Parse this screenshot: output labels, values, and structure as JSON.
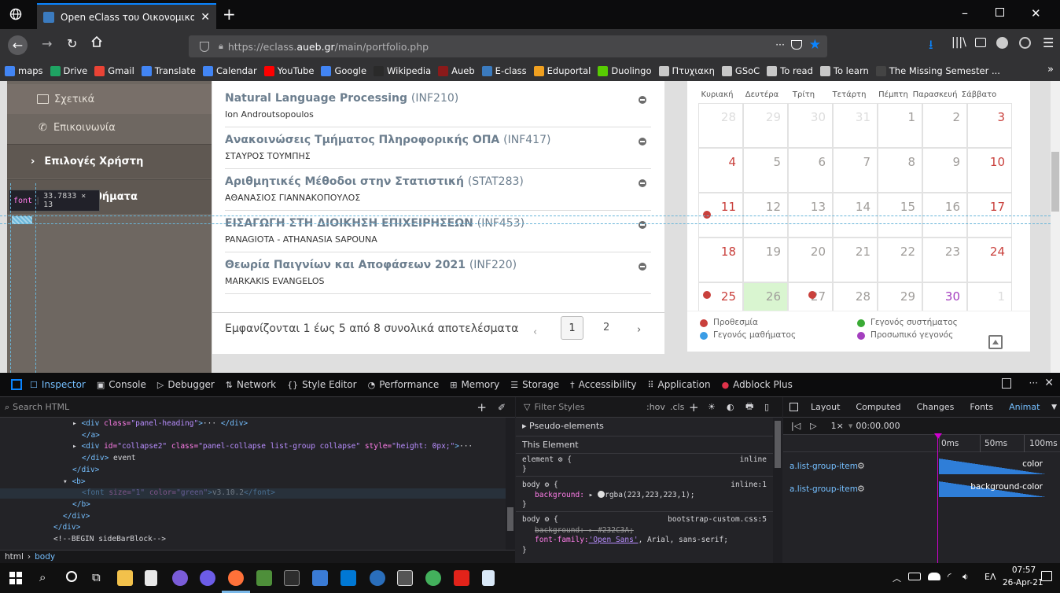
{
  "browser": {
    "tab_title": "Open eClass του Οικονομικού",
    "url_prefix": "https://eclass.",
    "url_domain": "aueb.gr",
    "url_path": "/main/portfolio.php",
    "url_more": "···"
  },
  "bookmarks": [
    {
      "label": "maps",
      "color": "#4285f4"
    },
    {
      "label": "Drive",
      "color": "#1fa463"
    },
    {
      "label": "Gmail",
      "color": "#ea4335"
    },
    {
      "label": "Translate",
      "color": "#4285f4"
    },
    {
      "label": "Calendar",
      "color": "#4285f4"
    },
    {
      "label": "YouTube",
      "color": "#ff0000"
    },
    {
      "label": "Google",
      "color": "#4285f4"
    },
    {
      "label": "Wikipedia",
      "color": "#2a2a2a"
    },
    {
      "label": "Aueb",
      "color": "#8b1a1a"
    },
    {
      "label": "E-class",
      "color": "#3b7bbf"
    },
    {
      "label": "Eduportal",
      "color": "#f0a020"
    },
    {
      "label": "Duolingo",
      "color": "#58cc02"
    },
    {
      "label": "Πτυχιακη",
      "color": "#c8c8c8"
    },
    {
      "label": "GSoC",
      "color": "#c8c8c8"
    },
    {
      "label": "To read",
      "color": "#c8c8c8"
    },
    {
      "label": "To learn",
      "color": "#c8c8c8"
    },
    {
      "label": "The Missing Semester ...",
      "color": "#444"
    }
  ],
  "sidebar": {
    "items": [
      "Σχετικά",
      "Επικοινωνία",
      "Επιλογές Χρήστη",
      "θήματα"
    ],
    "font_tooltip": "font",
    "font_tooltip_dims": "33.7833 × 13"
  },
  "courses": [
    {
      "title": "Natural Language Processing",
      "code": "(INF210)",
      "prof": "Ion Androutsopoulos"
    },
    {
      "title": "Ανακοινώσεις Τμήματος Πληροφορικής ΟΠΑ",
      "code": "(INF417)",
      "prof": "ΣΤΑΥΡΟΣ ΤΟΥΜΠΗΣ"
    },
    {
      "title": "Αριθμητικές Μέθοδοι στην Στατιστική",
      "code": "(STAT283)",
      "prof": "ΑΘΑΝΑΣΙΟΣ ΓΙΑΝΝΑΚΟΠΟΥΛΟΣ"
    },
    {
      "title": "ΕΙΣΑΓΩΓΗ ΣΤΗ ΔΙΟΙΚΗΣΗ ΕΠΙΧΕΙΡΗΣΕΩΝ",
      "code": "(INF453)",
      "prof": "PANAGIOTA - ATHANASIA SAPOUNA"
    },
    {
      "title": "Θεωρία Παιγνίων και Αποφάσεων 2021",
      "code": "(INF220)",
      "prof": "MARKAKIS EVANGELOS"
    }
  ],
  "pagination": {
    "summary": "Εμφανίζονται 1 έως 5 από 8 συνολικά αποτελέσματα",
    "prev": "‹",
    "page1": "1",
    "page2": "2",
    "next": "›"
  },
  "calendar": {
    "weekdays": [
      "Κυριακή",
      "Δευτέρα",
      "Τρίτη",
      "Τετάρτη",
      "Πέμπτη",
      "Παρασκευή",
      "Σάββατο"
    ],
    "weeks": [
      [
        "28",
        "29",
        "30",
        "31",
        "1",
        "2",
        "3"
      ],
      [
        "4",
        "5",
        "6",
        "7",
        "8",
        "9",
        "10"
      ],
      [
        "11",
        "12",
        "13",
        "14",
        "15",
        "16",
        "17"
      ],
      [
        "18",
        "19",
        "20",
        "21",
        "22",
        "23",
        "24"
      ],
      [
        "25",
        "26",
        "27",
        "28",
        "29",
        "30",
        "1"
      ]
    ],
    "today": "26",
    "legend": {
      "deadline": "Προθεσμία",
      "system": "Γεγονός συστήματος",
      "course": "Γεγονός μαθήματος",
      "personal": "Προσωπικό γεγονός"
    },
    "colors": {
      "deadline": "#c9403c",
      "system": "#3aaa35",
      "course": "#3b9de6",
      "personal": "#a43fbf",
      "today_bg": "#d9f5d0",
      "weekend": "#c9403c"
    }
  },
  "devtools": {
    "tabs": [
      "Inspector",
      "Console",
      "Debugger",
      "Network",
      "Style Editor",
      "Performance",
      "Memory",
      "Storage",
      "Accessibility",
      "Application",
      "Adblock Plus"
    ],
    "search_placeholder": "Search HTML",
    "html_lines": [
      {
        "indent": 7,
        "parts": [
          [
            "tx",
            "▸ "
          ],
          [
            "tg",
            "<div "
          ],
          [
            "at",
            "class="
          ],
          [
            "av",
            "\"panel-heading\""
          ],
          [
            "tg",
            ">"
          ],
          [
            "tx",
            "··· "
          ],
          [
            "tg",
            "</div>"
          ]
        ]
      },
      {
        "indent": 8,
        "parts": [
          [
            "tg",
            "</a>"
          ]
        ]
      },
      {
        "indent": 7,
        "parts": [
          [
            "tx",
            "▸ "
          ],
          [
            "tg",
            "<div "
          ],
          [
            "at",
            "id="
          ],
          [
            "av",
            "\"collapse2\" "
          ],
          [
            "at",
            "class="
          ],
          [
            "av",
            "\"panel-collapse list-group collapse\" "
          ],
          [
            "at",
            "style="
          ],
          [
            "av",
            "\"height: 0px;\""
          ],
          [
            "tg",
            ">"
          ],
          [
            "tx",
            "···"
          ]
        ]
      },
      {
        "indent": 8,
        "parts": [
          [
            "tg",
            "</div>"
          ],
          [
            "tx",
            " event"
          ]
        ]
      },
      {
        "indent": 7,
        "parts": [
          [
            "tg",
            "</div>"
          ]
        ]
      },
      {
        "indent": 6,
        "parts": [
          [
            "tx",
            "▾ "
          ],
          [
            "tg",
            "<b>"
          ]
        ]
      },
      {
        "indent": 8,
        "parts": [
          [
            "tg",
            "<font "
          ],
          [
            "at",
            "size="
          ],
          [
            "av",
            "\"1\" "
          ],
          [
            "at",
            "color="
          ],
          [
            "av",
            "\"green\""
          ],
          [
            "tg",
            ">"
          ],
          [
            "tx",
            "v3.10.2"
          ],
          [
            "tg",
            "</font>"
          ]
        ]
      },
      {
        "indent": 7,
        "parts": [
          [
            "tg",
            "</b>"
          ]
        ]
      },
      {
        "indent": 6,
        "parts": [
          [
            "tg",
            "</div>"
          ]
        ]
      },
      {
        "indent": 5,
        "parts": [
          [
            "tg",
            "</div>"
          ]
        ]
      },
      {
        "indent": 5,
        "parts": [
          [
            "tx",
            "<!--BEGIN sideBarBlock-->"
          ]
        ]
      }
    ],
    "breadcrumb": [
      "html",
      "body"
    ],
    "rules": {
      "filter_placeholder": "Filter Styles",
      "hov": ":hov",
      "cls": ".cls",
      "pseudo": "Pseudo-elements",
      "this_element": "This Element",
      "element_sel": "element",
      "element_src": "inline",
      "body1_sel": "body",
      "body1_src": "inline:1",
      "body1_prop": "background:",
      "body1_val": "rgba(223,223,223,1);",
      "body2_sel": "body",
      "body2_src": "bootstrap-custom.css:5",
      "body2_prop1": "background: ▸ #232C3A;",
      "body2_prop2": "font-family:",
      "body2_val2a": "'Open Sans'",
      "body2_val2b": ", Arial, sans-serif;"
    },
    "side_tabs": [
      "Layout",
      "Computed",
      "Changes",
      "Fonts",
      "Animat"
    ],
    "animation": {
      "rate": "1×",
      "time": "00:00.000",
      "ticks": [
        "0ms",
        "50ms",
        "100ms"
      ],
      "rows": [
        {
          "sel": "a.list-group-item",
          "prop": "color"
        },
        {
          "sel": "a.list-group-item",
          "prop": "background-color"
        }
      ]
    }
  },
  "taskbar": {
    "lang": "ΕΛ",
    "time": "07:57",
    "date": "26-Apr-21"
  }
}
